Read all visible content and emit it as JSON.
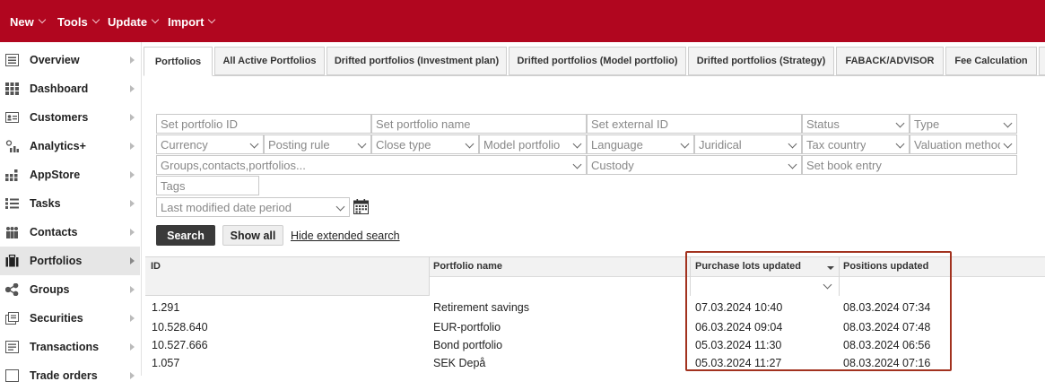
{
  "topnav": {
    "items": [
      {
        "label": "New"
      },
      {
        "label": "Tools"
      },
      {
        "label": "Update"
      },
      {
        "label": "Import"
      }
    ]
  },
  "sidebar": {
    "items": [
      {
        "label": "Overview",
        "icon": "overview-icon"
      },
      {
        "label": "Dashboard",
        "icon": "dashboard-icon"
      },
      {
        "label": "Customers",
        "icon": "customers-icon"
      },
      {
        "label": "Analytics+",
        "icon": "analytics-icon"
      },
      {
        "label": "AppStore",
        "icon": "appstore-icon"
      },
      {
        "label": "Tasks",
        "icon": "tasks-icon"
      },
      {
        "label": "Contacts",
        "icon": "contacts-icon"
      },
      {
        "label": "Portfolios",
        "icon": "portfolios-icon",
        "active": true
      },
      {
        "label": "Groups",
        "icon": "groups-icon"
      },
      {
        "label": "Securities",
        "icon": "securities-icon"
      },
      {
        "label": "Transactions",
        "icon": "transactions-icon"
      },
      {
        "label": "Trade orders",
        "icon": "trade-orders-icon"
      }
    ]
  },
  "tabs": [
    {
      "label": "Portfolios",
      "active": true
    },
    {
      "label": "All Active Portfolios"
    },
    {
      "label": "Drifted portfolios (Investment plan)"
    },
    {
      "label": "Drifted portfolios (Model portfolio)"
    },
    {
      "label": "Drifted portfolios (Strategy)"
    },
    {
      "label": "FABACK/ADVISOR"
    },
    {
      "label": "Fee Calculation"
    }
  ],
  "filters": {
    "portfolio_id": "Set portfolio ID",
    "portfolio_name": "Set portfolio name",
    "external_id": "Set external ID",
    "status": "Status",
    "type": "Type",
    "currency": "Currency",
    "posting_rule": "Posting rule",
    "close_type": "Close type",
    "model_portfolio": "Model portfolio",
    "language": "Language",
    "juridical": "Juridical",
    "tax_country": "Tax country",
    "valuation_method": "Valuation method",
    "groups": "Groups,contacts,portfolios...",
    "custody": "Custody",
    "book_entry": "Set book entry",
    "tags": "Tags",
    "last_modified": "Last modified date period"
  },
  "actions": {
    "search": "Search",
    "show_all": "Show all",
    "hide_extended": "Hide extended search"
  },
  "table": {
    "columns": [
      "ID",
      "Portfolio name",
      "Purchase lots updated",
      "Positions updated"
    ],
    "rows": [
      {
        "id": "1.291",
        "name": "Retirement savings",
        "purchase_lots": "07.03.2024 10:40",
        "positions": "08.03.2024 07:34"
      },
      {
        "id": "10.528.640",
        "name": "EUR-portfolio",
        "purchase_lots": "06.03.2024 09:04",
        "positions": "08.03.2024 07:48"
      },
      {
        "id": "10.527.666",
        "name": "Bond portfolio",
        "purchase_lots": "05.03.2024 11:30",
        "positions": "08.03.2024 06:56"
      },
      {
        "id": "1.057",
        "name": "SEK Depå",
        "purchase_lots": "05.03.2024 11:27",
        "positions": "08.03.2024 07:16"
      }
    ]
  },
  "colors": {
    "brand": "#b1061f",
    "highlight": "#a2321f"
  }
}
